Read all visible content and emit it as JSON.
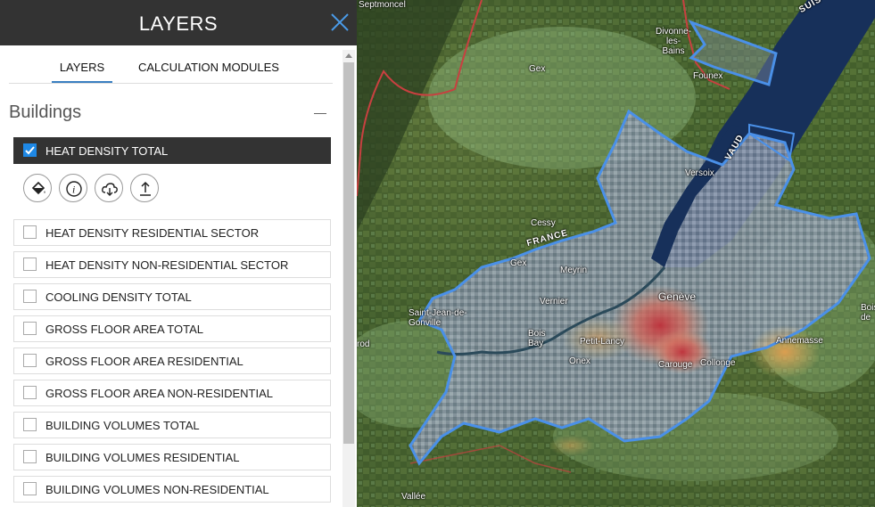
{
  "panel": {
    "title": "LAYERS",
    "tabs": {
      "layers": "LAYERS",
      "calc": "CALCULATION MODULES"
    },
    "section_title": "Buildings",
    "active_layer": "HEAT DENSITY TOTAL",
    "layers": [
      "HEAT DENSITY RESIDENTIAL SECTOR",
      "HEAT DENSITY NON-RESIDENTIAL SECTOR",
      "COOLING DENSITY TOTAL",
      "GROSS FLOOR AREA TOTAL",
      "GROSS FLOOR AREA RESIDENTIAL",
      "GROSS FLOOR AREA NON-RESIDENTIAL",
      "BUILDING VOLUMES TOTAL",
      "BUILDING VOLUMES RESIDENTIAL",
      "BUILDING VOLUMES NON-RESIDENTIAL"
    ],
    "tools": [
      "paint-bucket-icon",
      "info-icon",
      "cloud-download-icon",
      "upload-icon"
    ],
    "accent_color": "#1e88e5"
  },
  "map": {
    "labels": {
      "septmoncel": "Septmoncel",
      "suisse": "SUIS",
      "divonne": "Divonne-\nles-\nBains",
      "founex": "Founex",
      "gex": "Gex",
      "vaud": "VAUD",
      "versoix": "Versoix",
      "cessy": "Cessy",
      "france": "FRANCE",
      "cex": "Gex",
      "meyrin": "Meyrin",
      "vernier": "Vernier",
      "geneve": "Genève",
      "saint_jean": "Saint-Jean-de-\nGonville",
      "bois_bay": "Bois\nBay",
      "petit_lancy": "Petit-Lancy",
      "onex": "Onex",
      "carouge": "Carouge",
      "collex": "Collonge",
      "annemasse": "Annemasse",
      "bois_right": "Bois\nde",
      "vallee": "Vallée",
      "rod": "rod"
    }
  }
}
